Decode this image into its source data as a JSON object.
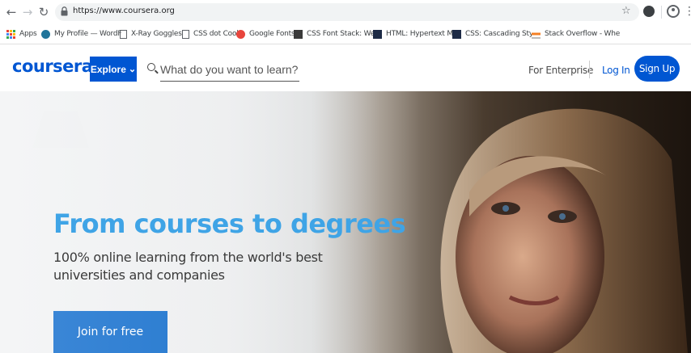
{
  "browser": {
    "url": "https://www.coursera.org",
    "bookmarks": [
      {
        "label": "Apps",
        "icon": "apps-grid-icon"
      },
      {
        "label": "My Profile — WordF",
        "icon": "wordpress-icon"
      },
      {
        "label": "X-Ray Goggles",
        "icon": "page-icon"
      },
      {
        "label": "CSS dot Cool",
        "icon": "page-icon"
      },
      {
        "label": "Google Fonts",
        "icon": "google-fonts-icon"
      },
      {
        "label": "CSS Font Stack: Web",
        "icon": "cssfontstack-icon"
      },
      {
        "label": "HTML: Hypertext Ma",
        "icon": "mdn-icon"
      },
      {
        "label": "CSS: Cascading Style",
        "icon": "mdn-icon"
      },
      {
        "label": "Stack Overflow - Whe",
        "icon": "stackoverflow-icon"
      }
    ]
  },
  "header": {
    "logo": "coursera",
    "explore_label": "Explore",
    "explore_caret": "⌄",
    "search_placeholder": "What do you want to learn?",
    "enterprise_label": "For Enterprise",
    "login_label": "Log In",
    "signup_label": "Sign Up"
  },
  "hero": {
    "title": "From courses to degrees",
    "subtitle": "100% online learning from the world's best universities and companies",
    "cta_label": "Join for free"
  },
  "colors": {
    "brand_blue": "#0056d2",
    "hero_title": "#3fa4e6"
  }
}
